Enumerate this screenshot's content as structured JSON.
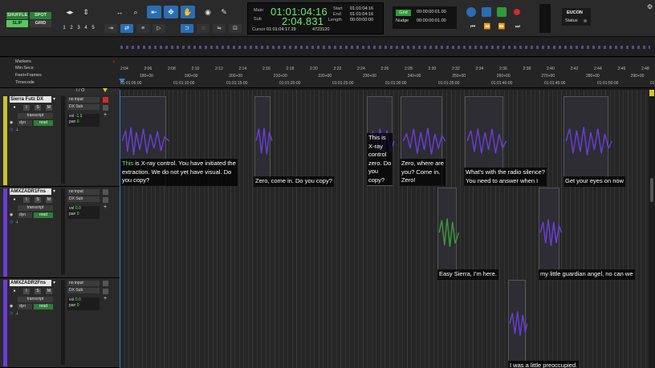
{
  "edit_modes": {
    "shuffle": "SHUFFLE",
    "spot": "SPOT",
    "slip": "SLIP",
    "grid": "GRID"
  },
  "zoom_presets": [
    "1",
    "2",
    "3",
    "4",
    "5"
  ],
  "counter": {
    "main_label": "Main",
    "sub_label": "Sub",
    "main_value": "01:01:04:16",
    "sub_value": "2:04.831",
    "start_label": "Start",
    "end_label": "End",
    "length_label": "Length",
    "start_value": "01:01:04:16",
    "end_value": "01:01:04:16",
    "length_value": "00:00:00:00",
    "cursor_label": "Cursor",
    "cursor_value": "01:01:04:17.29",
    "sample_value": "4723120"
  },
  "grid": {
    "grid_label": "Grid",
    "grid_value": "00:00:00:01.00",
    "nudge_label": "Nudge",
    "nudge_value": "00:00:00:01.00"
  },
  "eucon": {
    "label": "EUCON",
    "status_label": "Status"
  },
  "rulers": {
    "markers": "Markers",
    "min_secs": "Min:Secs",
    "feet_frames": "Feet+Frames",
    "timecode": "Timecode",
    "min_ticks": [
      "2:04",
      "2:06",
      "2:08",
      "2:10",
      "2:12",
      "2:14",
      "2:16",
      "2:18",
      "2:20",
      "2:22",
      "2:24",
      "2:26",
      "2:28",
      "2:30",
      "2:32",
      "2:34",
      "2:36",
      "2:38",
      "2:40",
      "2:42",
      "2:44",
      "2:46",
      "2:48"
    ],
    "ff_ticks": [
      "180+00",
      "190+00",
      "200+00",
      "210+00",
      "220+00",
      "230+00",
      "240+00",
      "250+00",
      "260+00",
      "270+00",
      "280+00",
      "290+00"
    ],
    "tc_ticks": [
      "01:01:05:00",
      "01:01:10:00",
      "01:01:15:00",
      "01:01:20:00",
      "01:01:25:00",
      "01:01:30:00",
      "01:01:35:00",
      "01:01:40:00",
      "01:01:45:00",
      "01:01:50:00",
      "01:01:55:00"
    ]
  },
  "io_label": "I / O",
  "tracks": [
    {
      "name": "Sierra Futz DX",
      "input": "no input",
      "output": "DX Sub",
      "mode": "transcript",
      "auto": "dyn",
      "auto_mode": "read",
      "vol": "-1.9",
      "pan": "0",
      "color": "#c9c42b"
    },
    {
      "name": "AMXZADR1Fns",
      "input": "no input",
      "output": "DX Sub",
      "mode": "transcript",
      "auto": "dyn",
      "auto_mode": "read",
      "vol": "0.0",
      "pan": "0",
      "color": "#6a3dd6"
    },
    {
      "name": "AMXZADR2Fns",
      "input": "no input",
      "output": "DX Sub",
      "mode": "transcript",
      "auto": "dyn",
      "auto_mode": "read",
      "vol": "0.0",
      "pan": "0",
      "color": "#6a3dd6"
    }
  ],
  "subtitles": {
    "s1_hl": "This",
    "s1": " is X-ray control. You have initiated the\nextraction. We do not yet have visual. Do\nyou copy?",
    "s2": "Zero, come in. Do you copy?",
    "s3": "This is\nX-ray\ncontrol\nzero. Do\nyou\ncopy?",
    "s4": "Zero, where are\nyou? Come in.\nZero!",
    "s5": "What's with the radio silence?\nYou need to answer when I",
    "s6": "Get your eyes on now",
    "s7": "Easy Sierra, I'm here.",
    "s8": "my little guardian angel, no can we",
    "s9": "I was a little preoccupied."
  }
}
